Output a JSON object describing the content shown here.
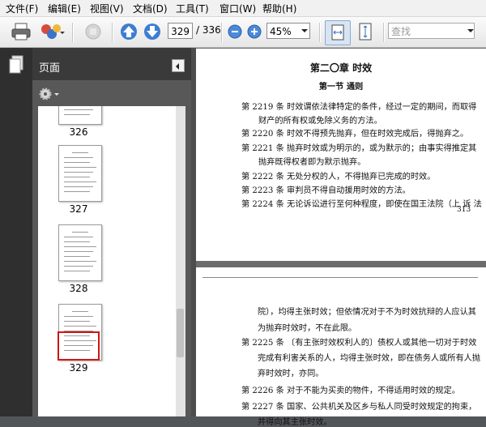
{
  "menu": [
    "文件(F)",
    "编辑(E)",
    "视图(V)",
    "文档(D)",
    "工具(T)",
    "窗口(W)",
    "帮助(H)"
  ],
  "toolbar": {
    "current_page": "329",
    "page_total": "/ 336",
    "zoom": "45%",
    "search_placeholder": "查找"
  },
  "nav_panel": {
    "title": "页面",
    "thumbnails": [
      {
        "page": "326",
        "selected": false
      },
      {
        "page": "327",
        "selected": false
      },
      {
        "page": "328",
        "selected": false
      },
      {
        "page": "329",
        "selected": true
      }
    ]
  },
  "colors": {
    "selection": "#d01515",
    "panel_bg": "#3c3c3c",
    "doc_bg": "#6c6c6c"
  },
  "page1": {
    "chapter": "第二〇章  时效",
    "section": "第一节  通则",
    "lines": [
      "第 2219 条  时效谓依法律特定的条件，经过一定的期间，而取得",
      "财产的所有权或免除义务的方法。",
      "第 2220 条  时效不得预先抛弃，但在时效完成后，得抛弃之。",
      "第 2221 条  抛弃时效或为明示的，或为默示的；由事实得推定其",
      "抛弃既得权者即为默示抛弃。",
      "第 2222 条  无处分权的人，不得抛弃已完成的时效。",
      "第 2223 条  审判员不得自动援用时效的方法。",
      "第 2224 条  无论诉讼进行至何种程度，即使在国王法院（上 诉 法"
    ],
    "page_number": "313"
  },
  "page2": {
    "lines": [
      "院），均得主张时效；但依情况对于不为时效抗辩的人应认其",
      "为抛弃时效时，不在此限。",
      "第 2225 条  〔有主张时效权利人的〕债权人或其他一切对于时效",
      "完成有利害关系的人，均得主张时效，即在债务人或所有人抛",
      "弃时效时，亦同。",
      "第 2226 条  对于不能为买卖的物件，不得适用时效的规定。",
      "第 2227 条  国家、公共机关及区乡与私人同受时效规定的拘束，",
      "并得向其主张时效。"
    ]
  }
}
